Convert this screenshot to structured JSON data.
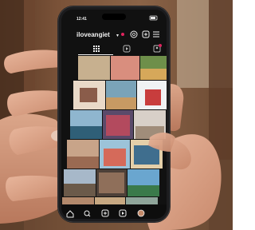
{
  "status_bar": {
    "time": "12:41"
  },
  "profile": {
    "username": "iloveangiet",
    "username_chevron": "▾"
  },
  "icons": {
    "header": [
      "threads-icon",
      "add-post-icon",
      "menu-icon"
    ],
    "profile_tabs": [
      "grid-tab-icon",
      "reels-tab-icon",
      "tagged-tab-icon"
    ],
    "bottom_nav": [
      "home-icon",
      "search-icon",
      "create-icon",
      "reels-icon",
      "profile-avatar"
    ]
  },
  "colors": {
    "notification_dot": "#e0245e",
    "screen_background": "#111111",
    "phone_frame": "#1c1c1e"
  }
}
